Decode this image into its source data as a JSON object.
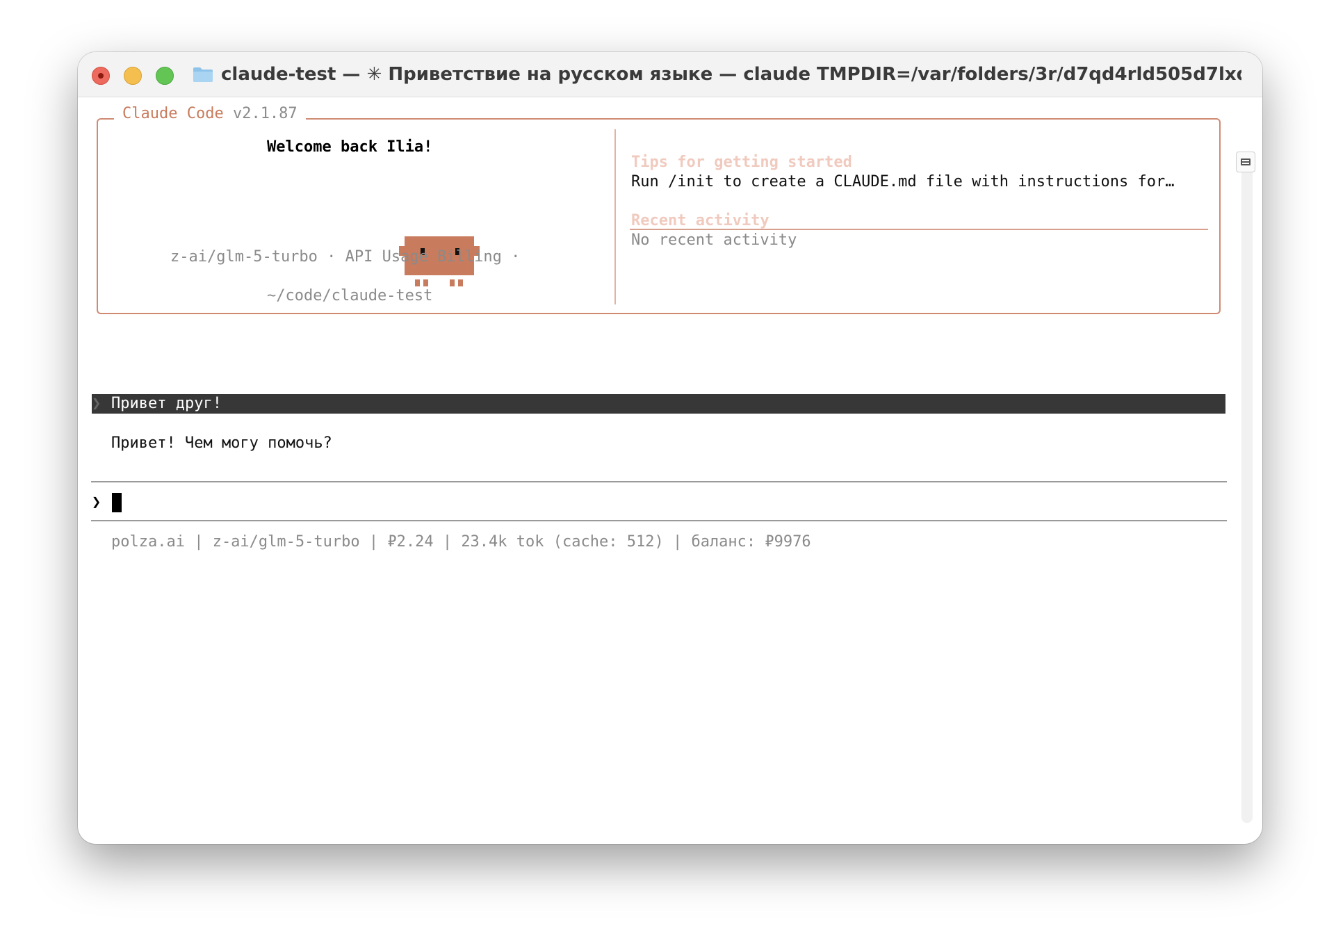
{
  "window": {
    "title": "claude-test — ✳ Приветствие на русском языке — claude TMPDIR=/var/folders/3r/d7qd4rld505d7lxdp57rtjnw00...",
    "icons": {
      "close": "close-dot",
      "minimize": "minimize-dot",
      "maximize": "maximize-dot",
      "folder": "folder-icon"
    }
  },
  "welcome_panel": {
    "app_name": "Claude Code",
    "version": "v2.1.87",
    "greeting": "Welcome back Ilia!",
    "model_line": "z-ai/glm-5-turbo · API Usage Billing ·",
    "cwd": "~/code/claude-test",
    "mascot_icon": "pixel-creature"
  },
  "tips_panel": {
    "tips_heading": "Tips for getting started",
    "tips_text": "Run /init to create a CLAUDE.md file with instructions for…",
    "recent_heading": "Recent activity",
    "recent_text": "No recent activity"
  },
  "conversation": {
    "prompt_glyph": "❯",
    "user_message": "Привет друг!",
    "assistant_message": "Привет! Чем могу помочь?"
  },
  "input": {
    "prompt_glyph": "❯",
    "value": ""
  },
  "status_line": "polza.ai | z-ai/glm-5-turbo | ₽2.24 | 23.4k tok (cache: 512) | баланс: ₽9976",
  "colors": {
    "accent": "#c97b5d",
    "muted_accent": "#f0cabe",
    "muted_text": "#8a8a8a",
    "user_bar": "#373737"
  }
}
